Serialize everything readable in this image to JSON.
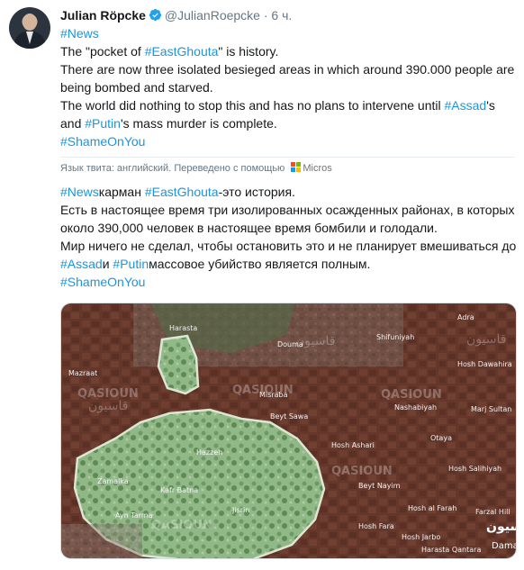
{
  "author": {
    "name": "Julian Röpcke",
    "handle": "@JulianRoepcke",
    "separator": "·",
    "time": "6 ч."
  },
  "tweet": {
    "tag1": "#News",
    "line2_a": "The \"pocket of ",
    "line2_tag": "#EastGhouta",
    "line2_b": "\" is history.",
    "line3": "There are now three isolated besieged areas in which around 390.000 people are",
    "line4": "being bombed and starved.",
    "line5_a": "The world did nothing to stop this and has no plans to intervene until ",
    "line5_tag": "#Assad",
    "line5_b": "'s",
    "line6_a": "and ",
    "line6_tag": "#Putin",
    "line6_b": "'s mass murder is complete.",
    "line7_tag": "#ShameOnYou"
  },
  "translation_bar": {
    "text": "Язык твита: английский. Переведено с помощью",
    "provider": "Micros"
  },
  "translated": {
    "l1_tag1": "#News",
    "l1_a": "карман ",
    "l1_tag2": "#EastGhouta",
    "l1_b": "-это история.",
    "l2": "Есть в настоящее время три изолированных осажденных районах, в которых",
    "l3": "около 390,000 человек в настоящее время бомбили и голодали.",
    "l4": "Мир ничего не сделал, чтобы остановить это и не планирует вмешиваться до",
    "l5_tag1": "#Assad",
    "l5_a": "и ",
    "l5_tag2": "#Putin",
    "l5_b": "массовое убийство является полным.",
    "l6_tag": "#ShameOnYou"
  },
  "map": {
    "labels": {
      "harasta": "Harasta",
      "douma": "Douma",
      "misraba": "Misraba",
      "beyt_sawa": "Beyt Sawa",
      "hosh_ashari": "Hosh Ashari",
      "nashabiyah": "Nashabiyah",
      "otaya": "Otaya",
      "hosh_salihiyah": "Hosh Salihiyah",
      "beyt_nayim": "Beyt Nayim",
      "nushabiya_2": "Nushabiya",
      "faraal_hill": "Farzal Hill",
      "hosh_al_farah": "Hosh al Farah",
      "jisrin": "Jisrin",
      "kafr_batna": "Kafr Batna",
      "zamalka": "Zamalka",
      "ayn_tarma": "Ayn Tarma",
      "hazzeh": "Hazzeh",
      "shifuniyah": "Shifuniyah",
      "hosh_dawahira": "Hosh Dawahira",
      "adra": "Adra",
      "marj_sultan": "Marj Sultan",
      "hosh_fara": "Hosh Fara",
      "hosh_jarbo": "Hosh Jarbo",
      "harasta_qantara": "Harasta Qantara",
      "mazraat": "Mazraat",
      "damascus": "Damas",
      "watermark": "QASIOUN",
      "qasioun_ar": "قاسيون"
    },
    "colors": {
      "terrain": "#6b3a2e",
      "pocket_fill": "#9fc79a",
      "pocket_border": "#d8ead2"
    }
  }
}
